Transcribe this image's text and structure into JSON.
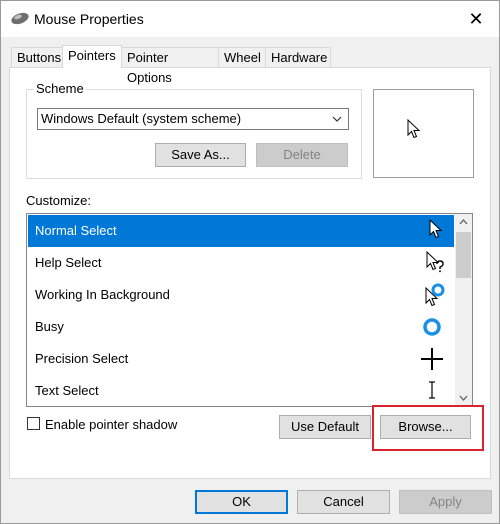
{
  "window": {
    "title": "Mouse Properties",
    "close_glyph": "✕"
  },
  "tabs": [
    "Buttons",
    "Pointers",
    "Pointer Options",
    "Wheel",
    "Hardware"
  ],
  "active_tab": "Pointers",
  "scheme": {
    "legend": "Scheme",
    "selected": "Windows Default (system scheme)",
    "save_as_label": "Save As...",
    "delete_label": "Delete"
  },
  "customize": {
    "label": "Customize:",
    "items": [
      {
        "label": "Normal Select",
        "icon": "arrow-pointer-icon"
      },
      {
        "label": "Help Select",
        "icon": "help-pointer-icon"
      },
      {
        "label": "Working In Background",
        "icon": "working-pointer-icon"
      },
      {
        "label": "Busy",
        "icon": "busy-pointer-icon"
      },
      {
        "label": "Precision Select",
        "icon": "crosshair-pointer-icon"
      },
      {
        "label": "Text Select",
        "icon": "ibeam-pointer-icon"
      }
    ],
    "selected_index": 0
  },
  "shadow": {
    "label": "Enable pointer shadow",
    "checked": false
  },
  "buttons": {
    "use_default": "Use Default",
    "browse": "Browse...",
    "ok": "OK",
    "cancel": "Cancel",
    "apply": "Apply"
  },
  "colors": {
    "accent": "#0078d7",
    "highlight_box": "#d9232d"
  }
}
